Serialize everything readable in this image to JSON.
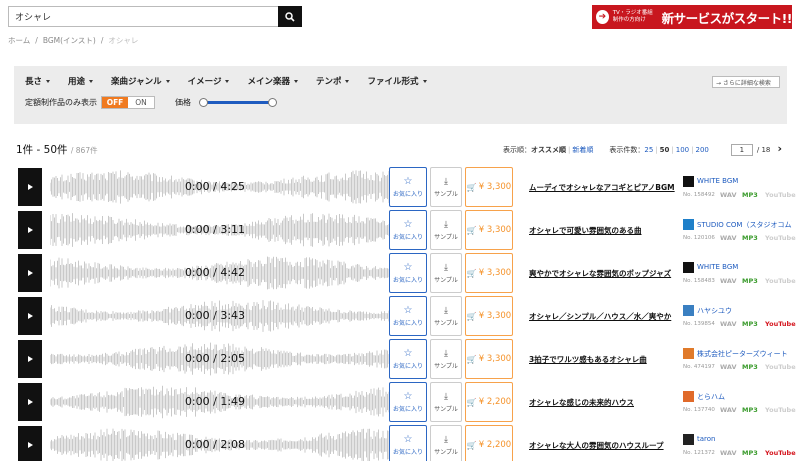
{
  "search": {
    "value": "オシャレ"
  },
  "banner": {
    "small_line1": "TV・ラジオ番組",
    "small_line2": "制作の方向け",
    "big": "新サービスがスタート!!"
  },
  "breadcrumb": {
    "home": "ホーム",
    "category": "BGM(インスト)",
    "current": "オシャレ",
    "sep": "/"
  },
  "filters": {
    "items": [
      "長さ",
      "用途",
      "楽曲ジャンル",
      "イメージ",
      "メイン楽器",
      "テンポ",
      "ファイル形式"
    ],
    "detail_search": "→ さらに詳細な検索",
    "fixed_label": "定額制作品のみ表示",
    "toggle_off": "OFF",
    "toggle_on": "ON",
    "price_label": "価格"
  },
  "results": {
    "range": "1件 - 50件",
    "total": "/ 867件",
    "sort_label": "表示順：",
    "sort_active": "オススメ順",
    "sort_sep": "|",
    "sort_new": "新着順",
    "count_label": "表示件数：",
    "count_25": "25",
    "count_50": "50",
    "count_100": "100",
    "count_200": "200",
    "page": "1",
    "page_total": "/ 18",
    "next": "›"
  },
  "labels": {
    "fav": "お気に入り",
    "sample": "サンプル",
    "wav": "WAV",
    "mp3": "MP3",
    "youtube": "YouTube",
    "cart": "🛒"
  },
  "tracks": [
    {
      "time": "0:00 / 4:25",
      "price": "¥ 3,300",
      "title": "ムーディでオシャレなアコギとピアノBGM",
      "artist": "WHITE BGM",
      "no": "No. 158492",
      "youtube": false,
      "logo_color": "#111"
    },
    {
      "time": "0:00 / 3:11",
      "price": "¥ 3,300",
      "title": "オシャレで可愛い雰囲気のある曲",
      "artist": "STUDIO COM（スタジオコム）",
      "no": "No. 120106",
      "youtube": false,
      "logo_color": "#1e7fc9"
    },
    {
      "time": "0:00 / 4:42",
      "price": "¥ 3,300",
      "title": "爽やかでオシャレな雰囲気のポップジャズ",
      "artist": "WHITE BGM",
      "no": "No. 158483",
      "youtube": false,
      "logo_color": "#111"
    },
    {
      "time": "0:00 / 3:43",
      "price": "¥ 3,300",
      "title": "オシャレ／シンプル／ハウス／水／爽やか",
      "artist": "ハヤシユウ",
      "no": "No. 139854",
      "youtube": true,
      "logo_color": "#3a7fc1"
    },
    {
      "time": "0:00 / 2:05",
      "price": "¥ 3,300",
      "title": "3拍子でワルツ感もあるオシャレ曲",
      "artist": "株式会社ピーターズウィート",
      "no": "No. 474197",
      "youtube": false,
      "logo_color": "#e07a2a"
    },
    {
      "time": "0:00 / 1:49",
      "price": "¥ 2,200",
      "title": "オシャレな感じの未来的ハウス",
      "artist": "とらハム",
      "no": "No. 137740",
      "youtube": false,
      "logo_color": "#e06a2a"
    },
    {
      "time": "0:00 / 2:08",
      "price": "¥ 2,200",
      "title": "オシャレな大人の雰囲気のハウスループ",
      "artist": "taron",
      "no": "No. 121372",
      "youtube": true,
      "logo_color": "#222"
    }
  ]
}
